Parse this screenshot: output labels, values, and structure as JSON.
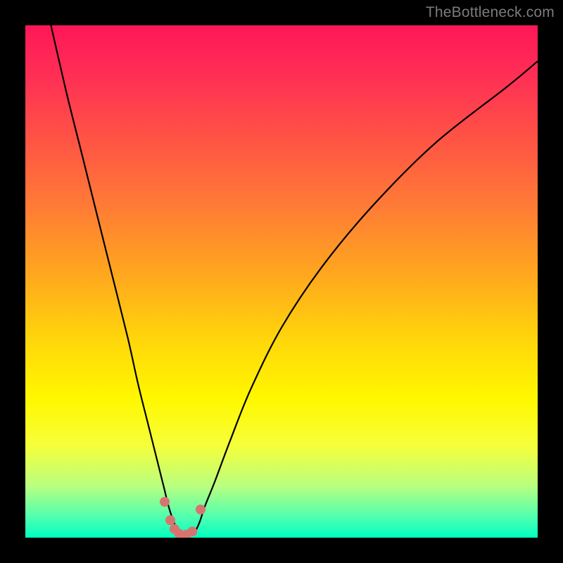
{
  "watermark": "TheBottleneck.com",
  "colors": {
    "frame": "#000000",
    "gradient_top": "#ff1757",
    "gradient_mid": "#ffd80a",
    "gradient_bottom": "#00ffc0",
    "curve": "#000000",
    "points": "#d8746f"
  },
  "chart_data": {
    "type": "line",
    "title": "",
    "xlabel": "",
    "ylabel": "",
    "xlim": [
      0,
      100
    ],
    "ylim": [
      0,
      100
    ],
    "series": [
      {
        "name": "curve",
        "x": [
          5,
          8,
          11,
          14,
          17,
          20,
          22,
          24,
          26,
          27,
          28,
          29,
          30,
          31,
          32,
          33,
          34,
          35,
          37,
          40,
          44,
          50,
          58,
          68,
          80,
          94,
          100
        ],
        "y": [
          100,
          87,
          75,
          63,
          51,
          39,
          30,
          22,
          14,
          10,
          6,
          3,
          1,
          0.4,
          0.4,
          1,
          3,
          6,
          11,
          19,
          29,
          41,
          53,
          65,
          77,
          88,
          93
        ]
      }
    ],
    "points": [
      {
        "x": 27.2,
        "y": 7.0
      },
      {
        "x": 28.3,
        "y": 3.4
      },
      {
        "x": 29.1,
        "y": 1.7
      },
      {
        "x": 30.0,
        "y": 0.8
      },
      {
        "x": 31.5,
        "y": 0.6
      },
      {
        "x": 32.6,
        "y": 1.2
      },
      {
        "x": 34.2,
        "y": 5.5
      }
    ]
  }
}
